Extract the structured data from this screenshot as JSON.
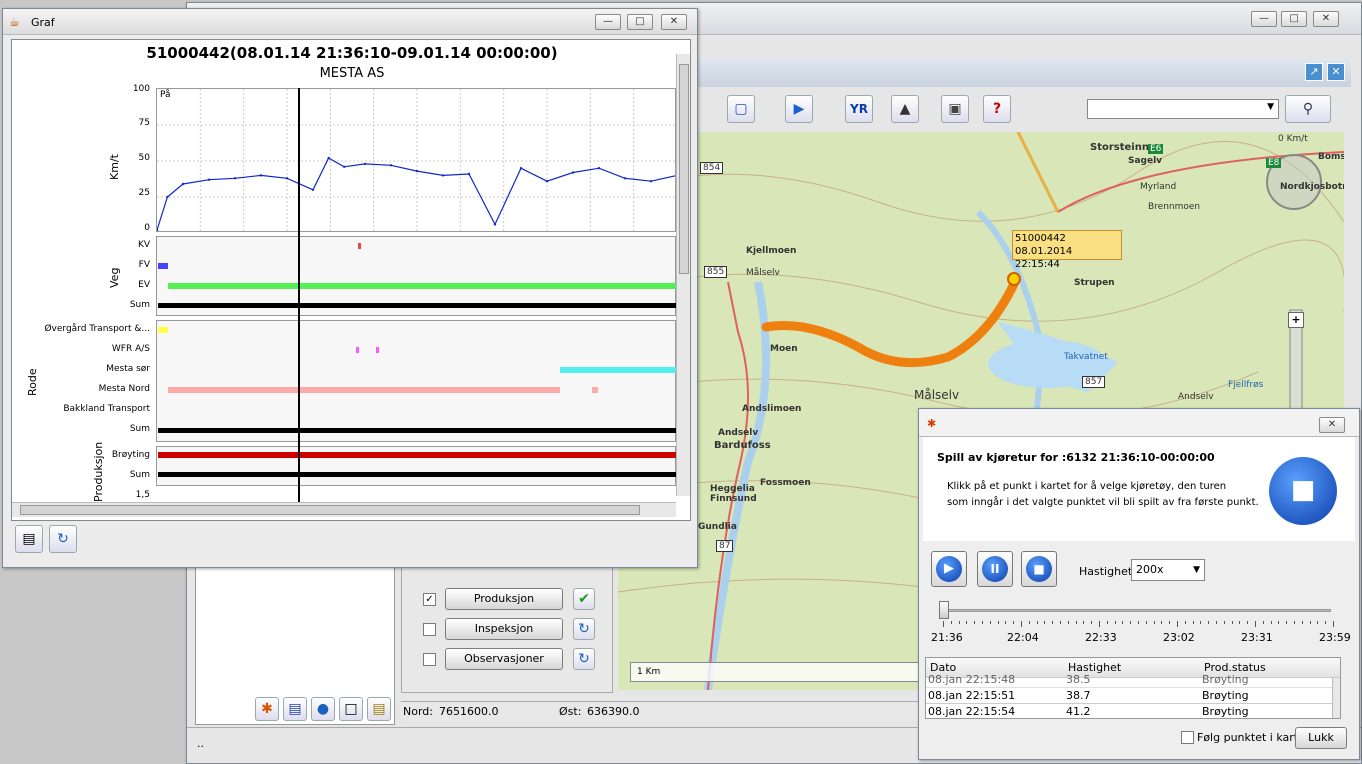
{
  "main_window": {
    "search_placeholder": "",
    "status_text": "..",
    "nord_label": "Nord:",
    "nord_value": "7651600.0",
    "ost_label": "Øst:",
    "ost_value": "636390.0",
    "checks": [
      {
        "label": "Produksjon",
        "checked": true
      },
      {
        "label": "Inspeksjon",
        "checked": false
      },
      {
        "label": "Observasjoner",
        "checked": false
      }
    ],
    "scale_label": "1 Km",
    "toolbar_icons": [
      "ruler-icon",
      "play-icon",
      "yr-icon",
      "road-icon",
      "save-icon",
      "help-icon"
    ],
    "bottom_icons": [
      "asterisk-icon",
      "chart-icon",
      "globe-icon",
      "window-icon",
      "notepad-icon"
    ]
  },
  "map": {
    "tooltip_id": "51000442",
    "tooltip_time": "08.01.2014 22:15:44",
    "labels": [
      {
        "t": "Storsteinnes",
        "bold": true
      },
      {
        "t": "Sagelv",
        "bold": true
      },
      {
        "t": "Nordkjosbotn",
        "bold": true
      },
      {
        "t": "Bomsk",
        "bold": true
      },
      {
        "t": "Kjellmoen",
        "bold": true
      },
      {
        "t": "Målselv",
        "bold": false
      },
      {
        "t": "Moen",
        "bold": true
      },
      {
        "t": "Andslimoen",
        "bold": true
      },
      {
        "t": "Andselv",
        "bold": true
      },
      {
        "t": "Bardufoss",
        "bold": true
      },
      {
        "t": "Heggelia",
        "bold": true
      },
      {
        "t": "Finnsund",
        "bold": true
      },
      {
        "t": "Fossmoen",
        "bold": true
      },
      {
        "t": "Målselv",
        "bold": false
      },
      {
        "t": "Strupen",
        "bold": true
      },
      {
        "t": "Takvatnet",
        "bold": false
      },
      {
        "t": "Andselv",
        "bold": false
      },
      {
        "t": "Gundlia",
        "bold": true
      },
      {
        "t": "Brennmoen",
        "bold": false
      },
      {
        "t": "Myrland",
        "bold": false
      },
      {
        "t": "Fjellfrøs",
        "bold": false
      }
    ],
    "road_numbers": [
      "854",
      "855",
      "857",
      "87",
      "E6",
      "E8"
    ],
    "compass_label": "0 Km/t"
  },
  "graf": {
    "window_title": "Graf",
    "heading": "51000442(08.01.14 21:36:10-09.01.14 00:00:00)",
    "subheading": "MESTA AS",
    "speed_axis_label": "Km/t",
    "speed_corner_label": "På",
    "speed_ticks": [
      "100",
      "75",
      "50",
      "25",
      "0"
    ],
    "veg_axis_label": "Veg",
    "veg_rows": [
      "KV",
      "FV",
      "EV",
      "Sum"
    ],
    "rode_axis_label": "Rode",
    "rode_rows": [
      "Øvergård Transport &...",
      "WFR A/S",
      "Mesta sør",
      "Mesta Nord",
      "Bakkland Transport",
      "Sum"
    ],
    "prod_axis_label": "Produksjon",
    "prod_rows": [
      "Brøyting",
      "Sum"
    ],
    "extra_tick": "1,5",
    "colors": {
      "speed": "#1028c8",
      "kv": "#ee4444",
      "fv": "#4444ff",
      "ev": "#55ee55",
      "sum": "#000000",
      "ovg": "#ffff44",
      "wfr": "#ff55ff",
      "sor": "#55eeee",
      "nord": "#ffaaaa",
      "broyting": "#cc0000"
    }
  },
  "chart_data": {
    "type": "line",
    "title": "51000442(08.01.14 21:36:10-09.01.14 00:00:00)",
    "subtitle": "MESTA AS",
    "ylabel": "Km/t",
    "ylim": [
      0,
      100
    ],
    "x_fraction": [
      0.0,
      0.02,
      0.05,
      0.1,
      0.15,
      0.2,
      0.25,
      0.3,
      0.33,
      0.36,
      0.4,
      0.45,
      0.5,
      0.55,
      0.6,
      0.65,
      0.7,
      0.75,
      0.8,
      0.85,
      0.9,
      0.95,
      1.0
    ],
    "values": [
      2,
      25,
      34,
      37,
      38,
      40,
      38,
      30,
      52,
      46,
      48,
      47,
      43,
      40,
      41,
      6,
      45,
      36,
      42,
      45,
      38,
      36,
      40
    ]
  },
  "playback": {
    "title": "Spill av kjøretur for :6132 21:36:10-00:00:00",
    "desc1": "Klikk på et punkt i kartet for å velge kjøretøy, den turen",
    "desc2": "som inngår i det valgte punktet vil bli spilt av fra første punkt.",
    "speed_label": "Hastighet",
    "speed_value": "200x",
    "slider_value": 0,
    "time_ticks": [
      "21:36",
      "22:04",
      "22:33",
      "23:02",
      "23:31",
      "23:59"
    ],
    "table_headers": [
      "Dato",
      "Hastighet",
      "Prod.status"
    ],
    "table_rows": [
      {
        "dato": "08.jan 22:15:48",
        "hast": "38.5",
        "status": "Brøyting"
      },
      {
        "dato": "08.jan 22:15:51",
        "hast": "38.7",
        "status": "Brøyting"
      },
      {
        "dato": "08.jan 22:15:54",
        "hast": "41.2",
        "status": "Brøyting"
      }
    ],
    "follow_label": "Følg punktet i kart",
    "close_label": "Lukk"
  }
}
